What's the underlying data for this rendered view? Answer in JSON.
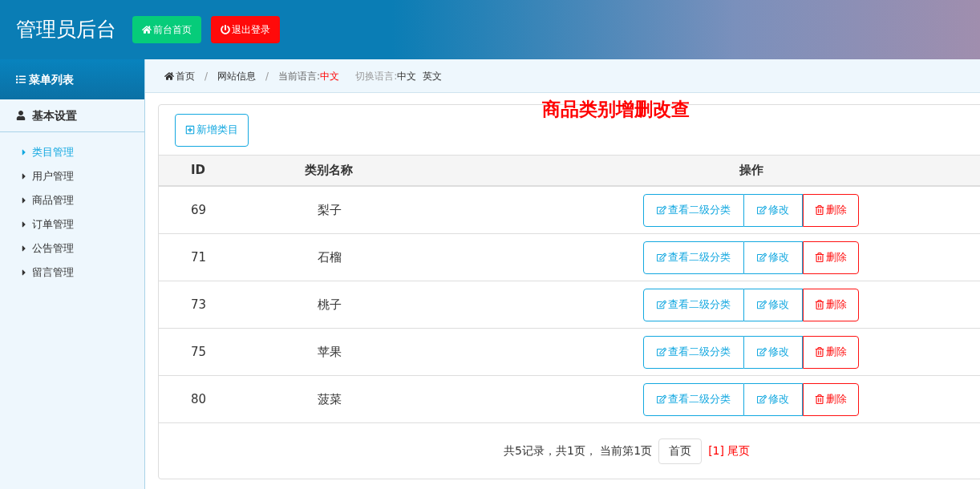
{
  "header": {
    "title": "管理员后台",
    "buttons": [
      {
        "kind": "home",
        "label": "前台首页"
      },
      {
        "kind": "logout",
        "label": "退出登录"
      }
    ]
  },
  "sidebar": {
    "heading": "菜单列表",
    "group": "基本设置",
    "items": [
      {
        "label": "类目管理",
        "selected": true
      },
      {
        "label": "用户管理",
        "selected": false
      },
      {
        "label": "商品管理",
        "selected": false
      },
      {
        "label": "订单管理",
        "selected": false
      },
      {
        "label": "公告管理",
        "selected": false
      },
      {
        "label": "留言管理",
        "selected": false
      }
    ]
  },
  "breadcrumb": {
    "home": "首页",
    "separators": [
      "/",
      "/"
    ],
    "section": "网站信息",
    "current_language_label": "当前语言:",
    "current_language": "中文",
    "switch_label": "切换语言:",
    "languages": [
      "中文",
      "英文"
    ]
  },
  "page_title": "商品类别增删改查",
  "add_button": "新增类目",
  "table": {
    "columns": [
      "ID",
      "类别名称",
      "操作"
    ],
    "rows": [
      {
        "id": "69",
        "name": "梨子",
        "actions": [
          {
            "kind": "view",
            "label": "查看二级分类"
          },
          {
            "kind": "edit",
            "label": "修改"
          },
          {
            "kind": "delete",
            "label": "删除"
          }
        ]
      },
      {
        "id": "71",
        "name": "石榴",
        "actions": [
          {
            "kind": "view",
            "label": "查看二级分类"
          },
          {
            "kind": "edit",
            "label": "修改"
          },
          {
            "kind": "delete",
            "label": "删除"
          }
        ]
      },
      {
        "id": "73",
        "name": "桃子",
        "actions": [
          {
            "kind": "view",
            "label": "查看二级分类"
          },
          {
            "kind": "edit",
            "label": "修改"
          },
          {
            "kind": "delete",
            "label": "删除"
          }
        ]
      },
      {
        "id": "75",
        "name": "苹果",
        "actions": [
          {
            "kind": "view",
            "label": "查看二级分类"
          },
          {
            "kind": "edit",
            "label": "修改"
          },
          {
            "kind": "delete",
            "label": "删除"
          }
        ]
      },
      {
        "id": "80",
        "name": "菠菜",
        "actions": [
          {
            "kind": "view",
            "label": "查看二级分类"
          },
          {
            "kind": "edit",
            "label": "修改"
          },
          {
            "kind": "delete",
            "label": "删除"
          }
        ]
      }
    ]
  },
  "pagination": {
    "summary": "共5记录，共1页， 当前第1页",
    "first": "首页",
    "page": "[1]",
    "last": "尾页"
  }
}
